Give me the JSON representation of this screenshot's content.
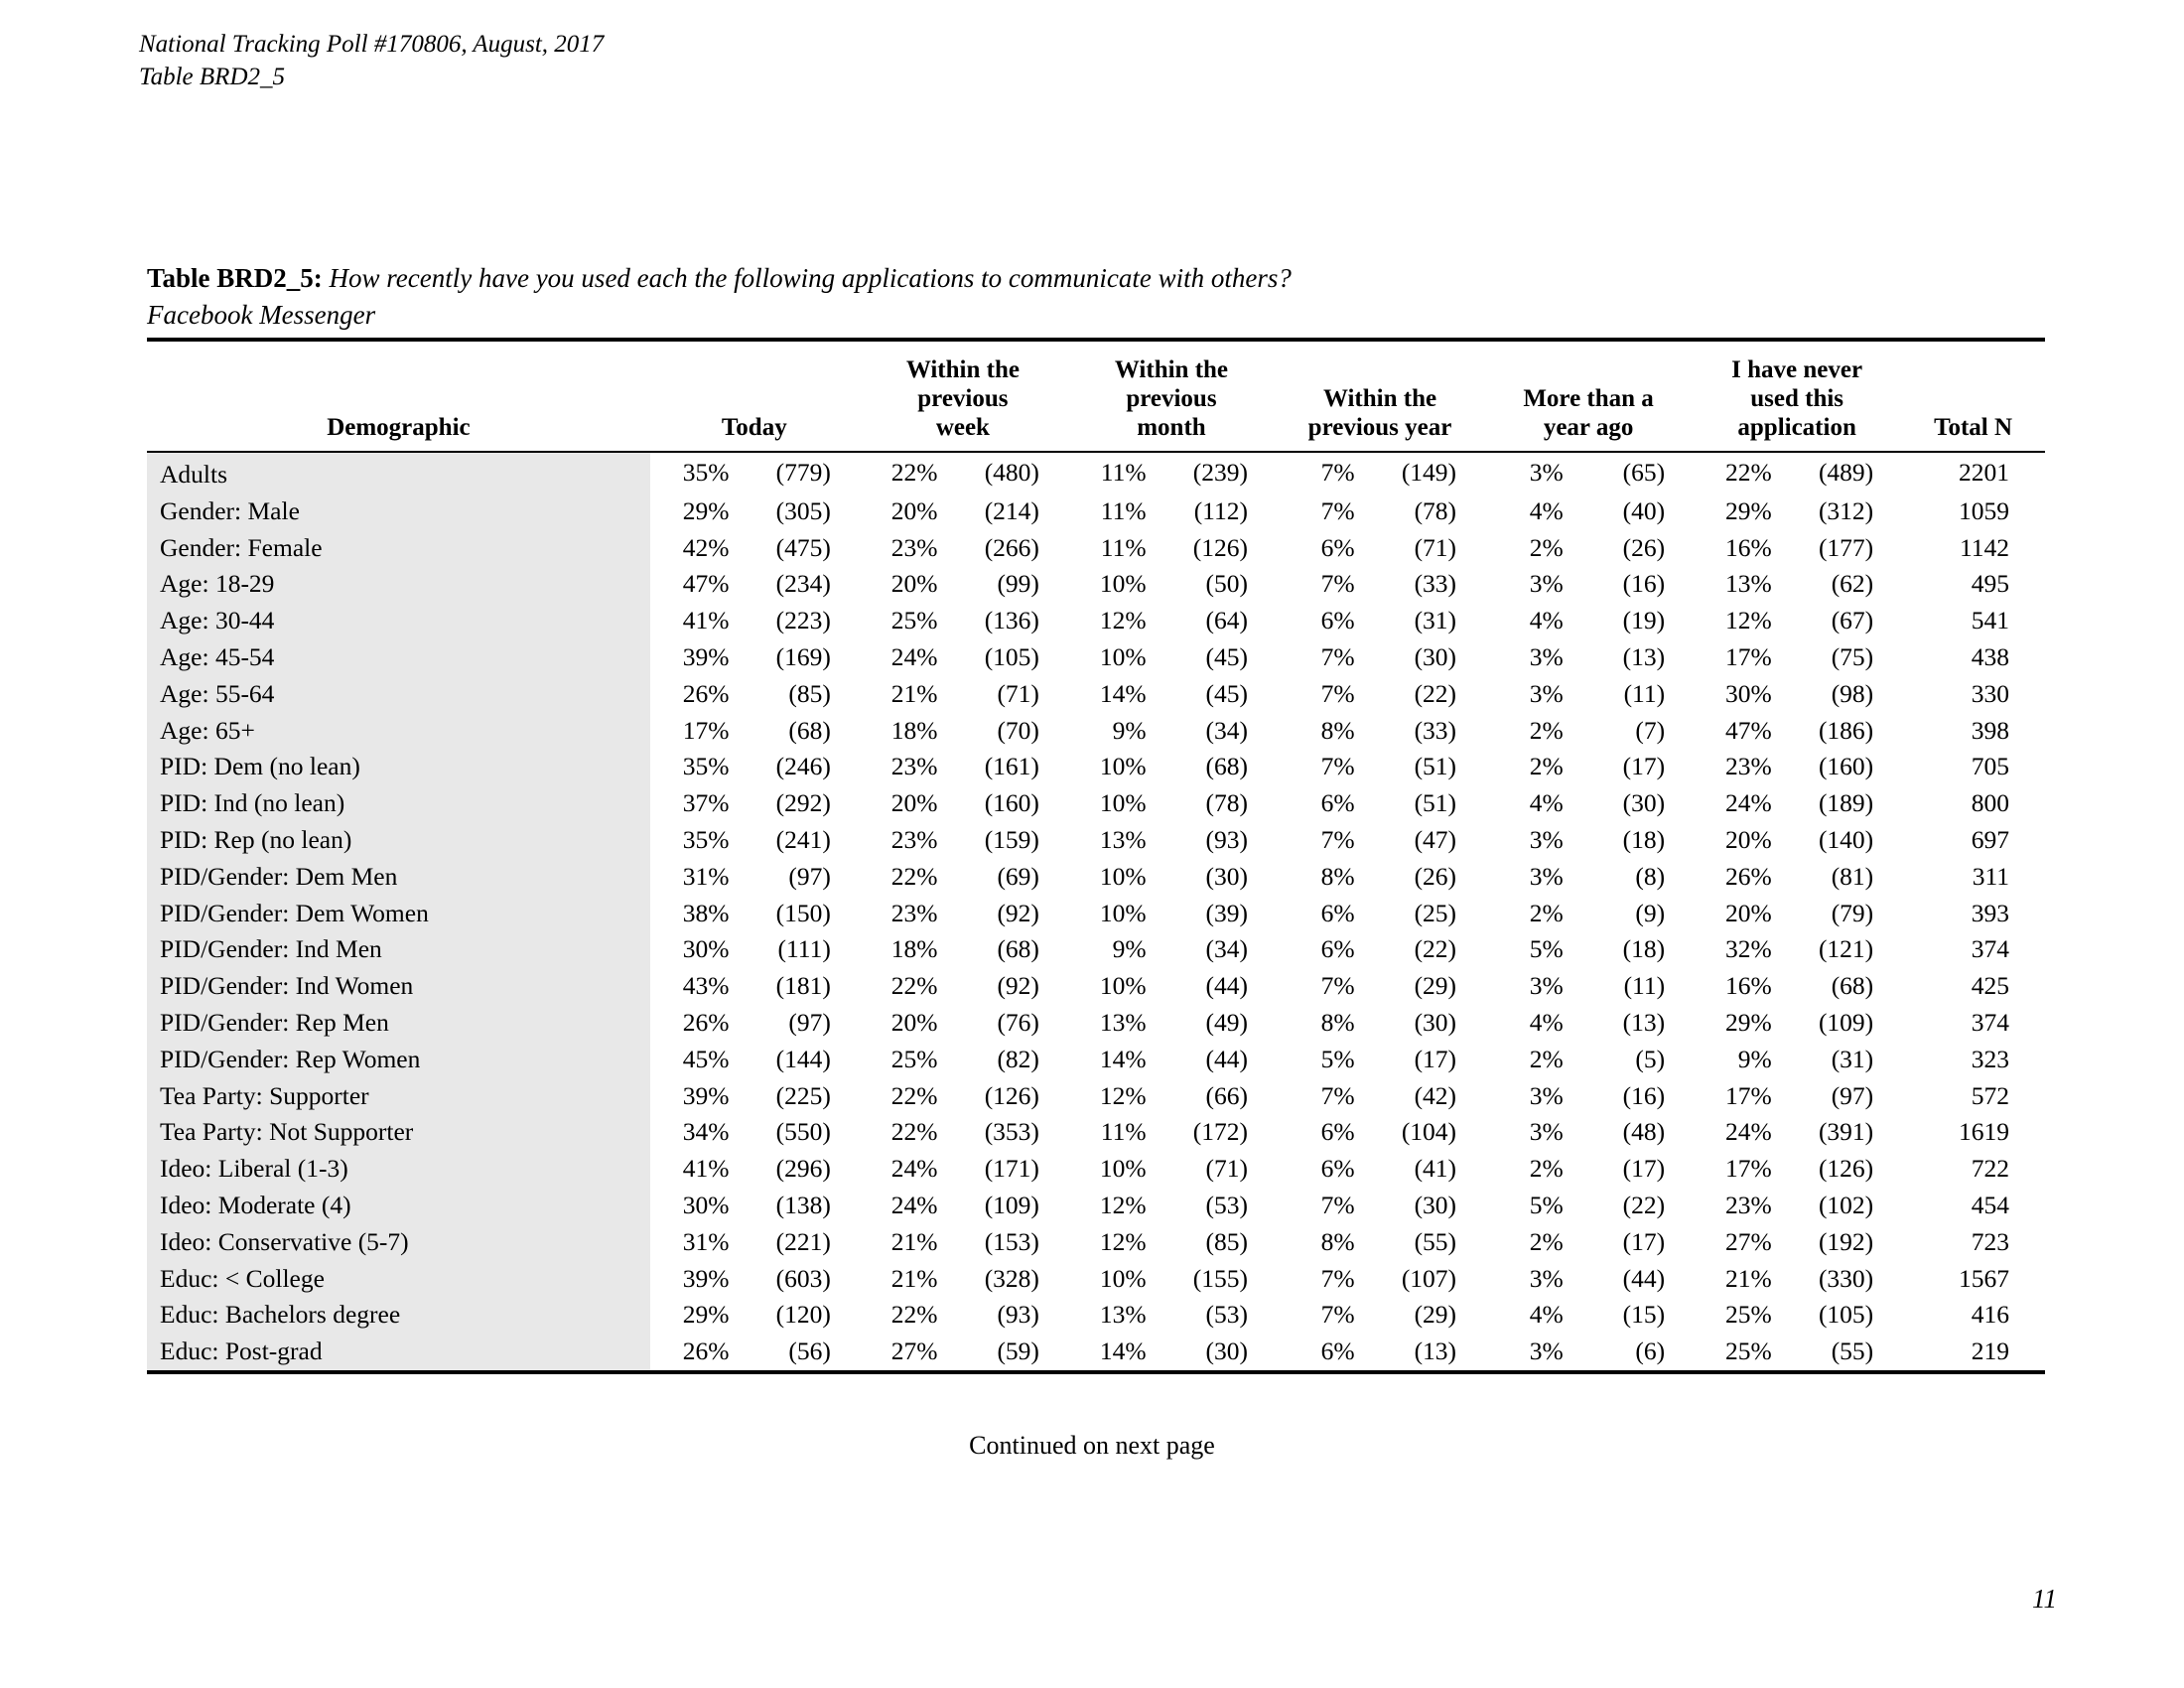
{
  "running_head": {
    "line1": "National Tracking Poll #170806, August, 2017",
    "line2": "Table BRD2_5"
  },
  "caption": {
    "label": "Table BRD2_5:",
    "question": "How recently have you used each the following applications to communicate with others?",
    "subject": "Facebook Messenger"
  },
  "footer": {
    "continued": "Continued on next page",
    "page_number": "11"
  },
  "chart_data": {
    "type": "table",
    "title": "Table BRD2_5: How recently have you used each the following applications to communicate with others?",
    "subtitle": "Facebook Messenger",
    "columns": [
      "Demographic",
      "Today",
      "Within the previous week",
      "Within the previous month",
      "Within the previous year",
      "More than a year ago",
      "I have never used this application",
      "Total N"
    ],
    "column_headers_wrapped": [
      [
        "Demographic"
      ],
      [
        "Today"
      ],
      [
        "Within the",
        "previous",
        "week"
      ],
      [
        "Within the",
        "previous",
        "month"
      ],
      [
        "Within the",
        "previous year"
      ],
      [
        "More than a",
        "year ago"
      ],
      [
        "I have never",
        "used this",
        "application"
      ],
      [
        "Total N"
      ]
    ],
    "rows": [
      {
        "demographic": "Adults",
        "today_pct": "35%",
        "today_n": "(779)",
        "week_pct": "22%",
        "week_n": "(480)",
        "month_pct": "11%",
        "month_n": "(239)",
        "year_pct": "7%",
        "year_n": "(149)",
        "over_year_pct": "3%",
        "over_year_n": "(65)",
        "never_pct": "22%",
        "never_n": "(489)",
        "total_n": "2201"
      },
      {
        "demographic": "Gender: Male",
        "today_pct": "29%",
        "today_n": "(305)",
        "week_pct": "20%",
        "week_n": "(214)",
        "month_pct": "11%",
        "month_n": "(112)",
        "year_pct": "7%",
        "year_n": "(78)",
        "over_year_pct": "4%",
        "over_year_n": "(40)",
        "never_pct": "29%",
        "never_n": "(312)",
        "total_n": "1059"
      },
      {
        "demographic": "Gender: Female",
        "today_pct": "42%",
        "today_n": "(475)",
        "week_pct": "23%",
        "week_n": "(266)",
        "month_pct": "11%",
        "month_n": "(126)",
        "year_pct": "6%",
        "year_n": "(71)",
        "over_year_pct": "2%",
        "over_year_n": "(26)",
        "never_pct": "16%",
        "never_n": "(177)",
        "total_n": "1142"
      },
      {
        "demographic": "Age: 18-29",
        "today_pct": "47%",
        "today_n": "(234)",
        "week_pct": "20%",
        "week_n": "(99)",
        "month_pct": "10%",
        "month_n": "(50)",
        "year_pct": "7%",
        "year_n": "(33)",
        "over_year_pct": "3%",
        "over_year_n": "(16)",
        "never_pct": "13%",
        "never_n": "(62)",
        "total_n": "495"
      },
      {
        "demographic": "Age: 30-44",
        "today_pct": "41%",
        "today_n": "(223)",
        "week_pct": "25%",
        "week_n": "(136)",
        "month_pct": "12%",
        "month_n": "(64)",
        "year_pct": "6%",
        "year_n": "(31)",
        "over_year_pct": "4%",
        "over_year_n": "(19)",
        "never_pct": "12%",
        "never_n": "(67)",
        "total_n": "541"
      },
      {
        "demographic": "Age: 45-54",
        "today_pct": "39%",
        "today_n": "(169)",
        "week_pct": "24%",
        "week_n": "(105)",
        "month_pct": "10%",
        "month_n": "(45)",
        "year_pct": "7%",
        "year_n": "(30)",
        "over_year_pct": "3%",
        "over_year_n": "(13)",
        "never_pct": "17%",
        "never_n": "(75)",
        "total_n": "438"
      },
      {
        "demographic": "Age: 55-64",
        "today_pct": "26%",
        "today_n": "(85)",
        "week_pct": "21%",
        "week_n": "(71)",
        "month_pct": "14%",
        "month_n": "(45)",
        "year_pct": "7%",
        "year_n": "(22)",
        "over_year_pct": "3%",
        "over_year_n": "(11)",
        "never_pct": "30%",
        "never_n": "(98)",
        "total_n": "330"
      },
      {
        "demographic": "Age: 65+",
        "today_pct": "17%",
        "today_n": "(68)",
        "week_pct": "18%",
        "week_n": "(70)",
        "month_pct": "9%",
        "month_n": "(34)",
        "year_pct": "8%",
        "year_n": "(33)",
        "over_year_pct": "2%",
        "over_year_n": "(7)",
        "never_pct": "47%",
        "never_n": "(186)",
        "total_n": "398"
      },
      {
        "demographic": "PID: Dem (no lean)",
        "today_pct": "35%",
        "today_n": "(246)",
        "week_pct": "23%",
        "week_n": "(161)",
        "month_pct": "10%",
        "month_n": "(68)",
        "year_pct": "7%",
        "year_n": "(51)",
        "over_year_pct": "2%",
        "over_year_n": "(17)",
        "never_pct": "23%",
        "never_n": "(160)",
        "total_n": "705"
      },
      {
        "demographic": "PID: Ind (no lean)",
        "today_pct": "37%",
        "today_n": "(292)",
        "week_pct": "20%",
        "week_n": "(160)",
        "month_pct": "10%",
        "month_n": "(78)",
        "year_pct": "6%",
        "year_n": "(51)",
        "over_year_pct": "4%",
        "over_year_n": "(30)",
        "never_pct": "24%",
        "never_n": "(189)",
        "total_n": "800"
      },
      {
        "demographic": "PID: Rep (no lean)",
        "today_pct": "35%",
        "today_n": "(241)",
        "week_pct": "23%",
        "week_n": "(159)",
        "month_pct": "13%",
        "month_n": "(93)",
        "year_pct": "7%",
        "year_n": "(47)",
        "over_year_pct": "3%",
        "over_year_n": "(18)",
        "never_pct": "20%",
        "never_n": "(140)",
        "total_n": "697"
      },
      {
        "demographic": "PID/Gender: Dem Men",
        "today_pct": "31%",
        "today_n": "(97)",
        "week_pct": "22%",
        "week_n": "(69)",
        "month_pct": "10%",
        "month_n": "(30)",
        "year_pct": "8%",
        "year_n": "(26)",
        "over_year_pct": "3%",
        "over_year_n": "(8)",
        "never_pct": "26%",
        "never_n": "(81)",
        "total_n": "311"
      },
      {
        "demographic": "PID/Gender: Dem Women",
        "today_pct": "38%",
        "today_n": "(150)",
        "week_pct": "23%",
        "week_n": "(92)",
        "month_pct": "10%",
        "month_n": "(39)",
        "year_pct": "6%",
        "year_n": "(25)",
        "over_year_pct": "2%",
        "over_year_n": "(9)",
        "never_pct": "20%",
        "never_n": "(79)",
        "total_n": "393"
      },
      {
        "demographic": "PID/Gender: Ind Men",
        "today_pct": "30%",
        "today_n": "(111)",
        "week_pct": "18%",
        "week_n": "(68)",
        "month_pct": "9%",
        "month_n": "(34)",
        "year_pct": "6%",
        "year_n": "(22)",
        "over_year_pct": "5%",
        "over_year_n": "(18)",
        "never_pct": "32%",
        "never_n": "(121)",
        "total_n": "374"
      },
      {
        "demographic": "PID/Gender: Ind Women",
        "today_pct": "43%",
        "today_n": "(181)",
        "week_pct": "22%",
        "week_n": "(92)",
        "month_pct": "10%",
        "month_n": "(44)",
        "year_pct": "7%",
        "year_n": "(29)",
        "over_year_pct": "3%",
        "over_year_n": "(11)",
        "never_pct": "16%",
        "never_n": "(68)",
        "total_n": "425"
      },
      {
        "demographic": "PID/Gender: Rep Men",
        "today_pct": "26%",
        "today_n": "(97)",
        "week_pct": "20%",
        "week_n": "(76)",
        "month_pct": "13%",
        "month_n": "(49)",
        "year_pct": "8%",
        "year_n": "(30)",
        "over_year_pct": "4%",
        "over_year_n": "(13)",
        "never_pct": "29%",
        "never_n": "(109)",
        "total_n": "374"
      },
      {
        "demographic": "PID/Gender: Rep Women",
        "today_pct": "45%",
        "today_n": "(144)",
        "week_pct": "25%",
        "week_n": "(82)",
        "month_pct": "14%",
        "month_n": "(44)",
        "year_pct": "5%",
        "year_n": "(17)",
        "over_year_pct": "2%",
        "over_year_n": "(5)",
        "never_pct": "9%",
        "never_n": "(31)",
        "total_n": "323"
      },
      {
        "demographic": "Tea Party: Supporter",
        "today_pct": "39%",
        "today_n": "(225)",
        "week_pct": "22%",
        "week_n": "(126)",
        "month_pct": "12%",
        "month_n": "(66)",
        "year_pct": "7%",
        "year_n": "(42)",
        "over_year_pct": "3%",
        "over_year_n": "(16)",
        "never_pct": "17%",
        "never_n": "(97)",
        "total_n": "572"
      },
      {
        "demographic": "Tea Party: Not Supporter",
        "today_pct": "34%",
        "today_n": "(550)",
        "week_pct": "22%",
        "week_n": "(353)",
        "month_pct": "11%",
        "month_n": "(172)",
        "year_pct": "6%",
        "year_n": "(104)",
        "over_year_pct": "3%",
        "over_year_n": "(48)",
        "never_pct": "24%",
        "never_n": "(391)",
        "total_n": "1619"
      },
      {
        "demographic": "Ideo: Liberal (1-3)",
        "today_pct": "41%",
        "today_n": "(296)",
        "week_pct": "24%",
        "week_n": "(171)",
        "month_pct": "10%",
        "month_n": "(71)",
        "year_pct": "6%",
        "year_n": "(41)",
        "over_year_pct": "2%",
        "over_year_n": "(17)",
        "never_pct": "17%",
        "never_n": "(126)",
        "total_n": "722"
      },
      {
        "demographic": "Ideo: Moderate (4)",
        "today_pct": "30%",
        "today_n": "(138)",
        "week_pct": "24%",
        "week_n": "(109)",
        "month_pct": "12%",
        "month_n": "(53)",
        "year_pct": "7%",
        "year_n": "(30)",
        "over_year_pct": "5%",
        "over_year_n": "(22)",
        "never_pct": "23%",
        "never_n": "(102)",
        "total_n": "454"
      },
      {
        "demographic": "Ideo: Conservative (5-7)",
        "today_pct": "31%",
        "today_n": "(221)",
        "week_pct": "21%",
        "week_n": "(153)",
        "month_pct": "12%",
        "month_n": "(85)",
        "year_pct": "8%",
        "year_n": "(55)",
        "over_year_pct": "2%",
        "over_year_n": "(17)",
        "never_pct": "27%",
        "never_n": "(192)",
        "total_n": "723"
      },
      {
        "demographic": "Educ: < College",
        "today_pct": "39%",
        "today_n": "(603)",
        "week_pct": "21%",
        "week_n": "(328)",
        "month_pct": "10%",
        "month_n": "(155)",
        "year_pct": "7%",
        "year_n": "(107)",
        "over_year_pct": "3%",
        "over_year_n": "(44)",
        "never_pct": "21%",
        "never_n": "(330)",
        "total_n": "1567"
      },
      {
        "demographic": "Educ: Bachelors degree",
        "today_pct": "29%",
        "today_n": "(120)",
        "week_pct": "22%",
        "week_n": "(93)",
        "month_pct": "13%",
        "month_n": "(53)",
        "year_pct": "7%",
        "year_n": "(29)",
        "over_year_pct": "4%",
        "over_year_n": "(15)",
        "never_pct": "25%",
        "never_n": "(105)",
        "total_n": "416"
      },
      {
        "demographic": "Educ: Post-grad",
        "today_pct": "26%",
        "today_n": "(56)",
        "week_pct": "27%",
        "week_n": "(59)",
        "month_pct": "14%",
        "month_n": "(30)",
        "year_pct": "6%",
        "year_n": "(13)",
        "over_year_pct": "3%",
        "over_year_n": "(6)",
        "never_pct": "25%",
        "never_n": "(55)",
        "total_n": "219"
      }
    ]
  }
}
